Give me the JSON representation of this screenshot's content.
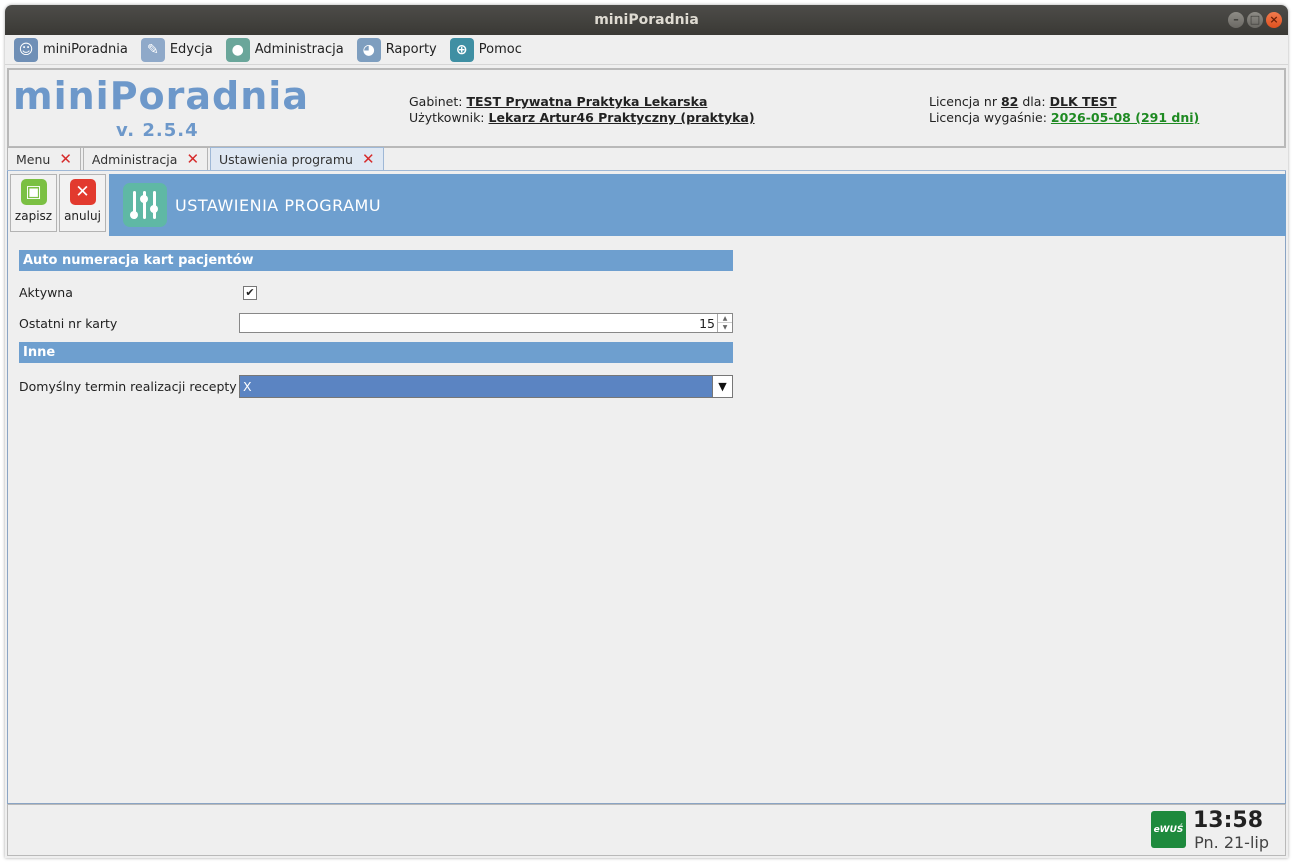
{
  "window": {
    "title": "miniPoradnia"
  },
  "menubar": {
    "items": [
      {
        "label": "miniPoradnia",
        "icon": "doctor-icon"
      },
      {
        "label": "Edycja",
        "icon": "edit-icon"
      },
      {
        "label": "Administracja",
        "icon": "admin-user-icon"
      },
      {
        "label": "Raporty",
        "icon": "report-icon"
      },
      {
        "label": "Pomoc",
        "icon": "help-lifebuoy-icon"
      }
    ]
  },
  "header": {
    "logo": "miniPoradnia",
    "version": "v. 2.5.4",
    "gabinet_label": "Gabinet:",
    "gabinet_value": "TEST Prywatna Praktyka Lekarska",
    "user_label": "Użytkownik:",
    "user_value": "Lekarz Artur46 Praktyczny (praktyka)",
    "license_label": "Licencja nr",
    "license_nr": "82",
    "license_for": "dla:",
    "license_holder": "DLK TEST",
    "expiry_label": "Licencja wygaśnie:",
    "expiry_value": "2026-05-08 (291 dni)",
    "expiry_color": "#1e8a22"
  },
  "tabs": [
    {
      "label": "Menu",
      "active": false
    },
    {
      "label": "Administracja",
      "active": false
    },
    {
      "label": "Ustawienia programu",
      "active": true
    }
  ],
  "toolbar": {
    "save_label": "zapisz",
    "cancel_label": "anuluj"
  },
  "banner": {
    "title": "USTAWIENIA PROGRAMU"
  },
  "form": {
    "section1_title": "Auto numeracja kart pacjentów",
    "active_label": "Aktywna",
    "active_checked": true,
    "last_card_label": "Ostatni nr karty",
    "last_card_value": "15",
    "section2_title": "Inne",
    "default_term_label": "Domyślny termin realizacji recepty",
    "default_term_value": "X"
  },
  "statusbar": {
    "ewus_label": "eWUŚ",
    "time": "13:58",
    "date": "Pn. 21-lip"
  },
  "colors": {
    "accent": "#6e9fcf",
    "logo": "#6d98ca",
    "combo_selected": "#5b84c2"
  }
}
